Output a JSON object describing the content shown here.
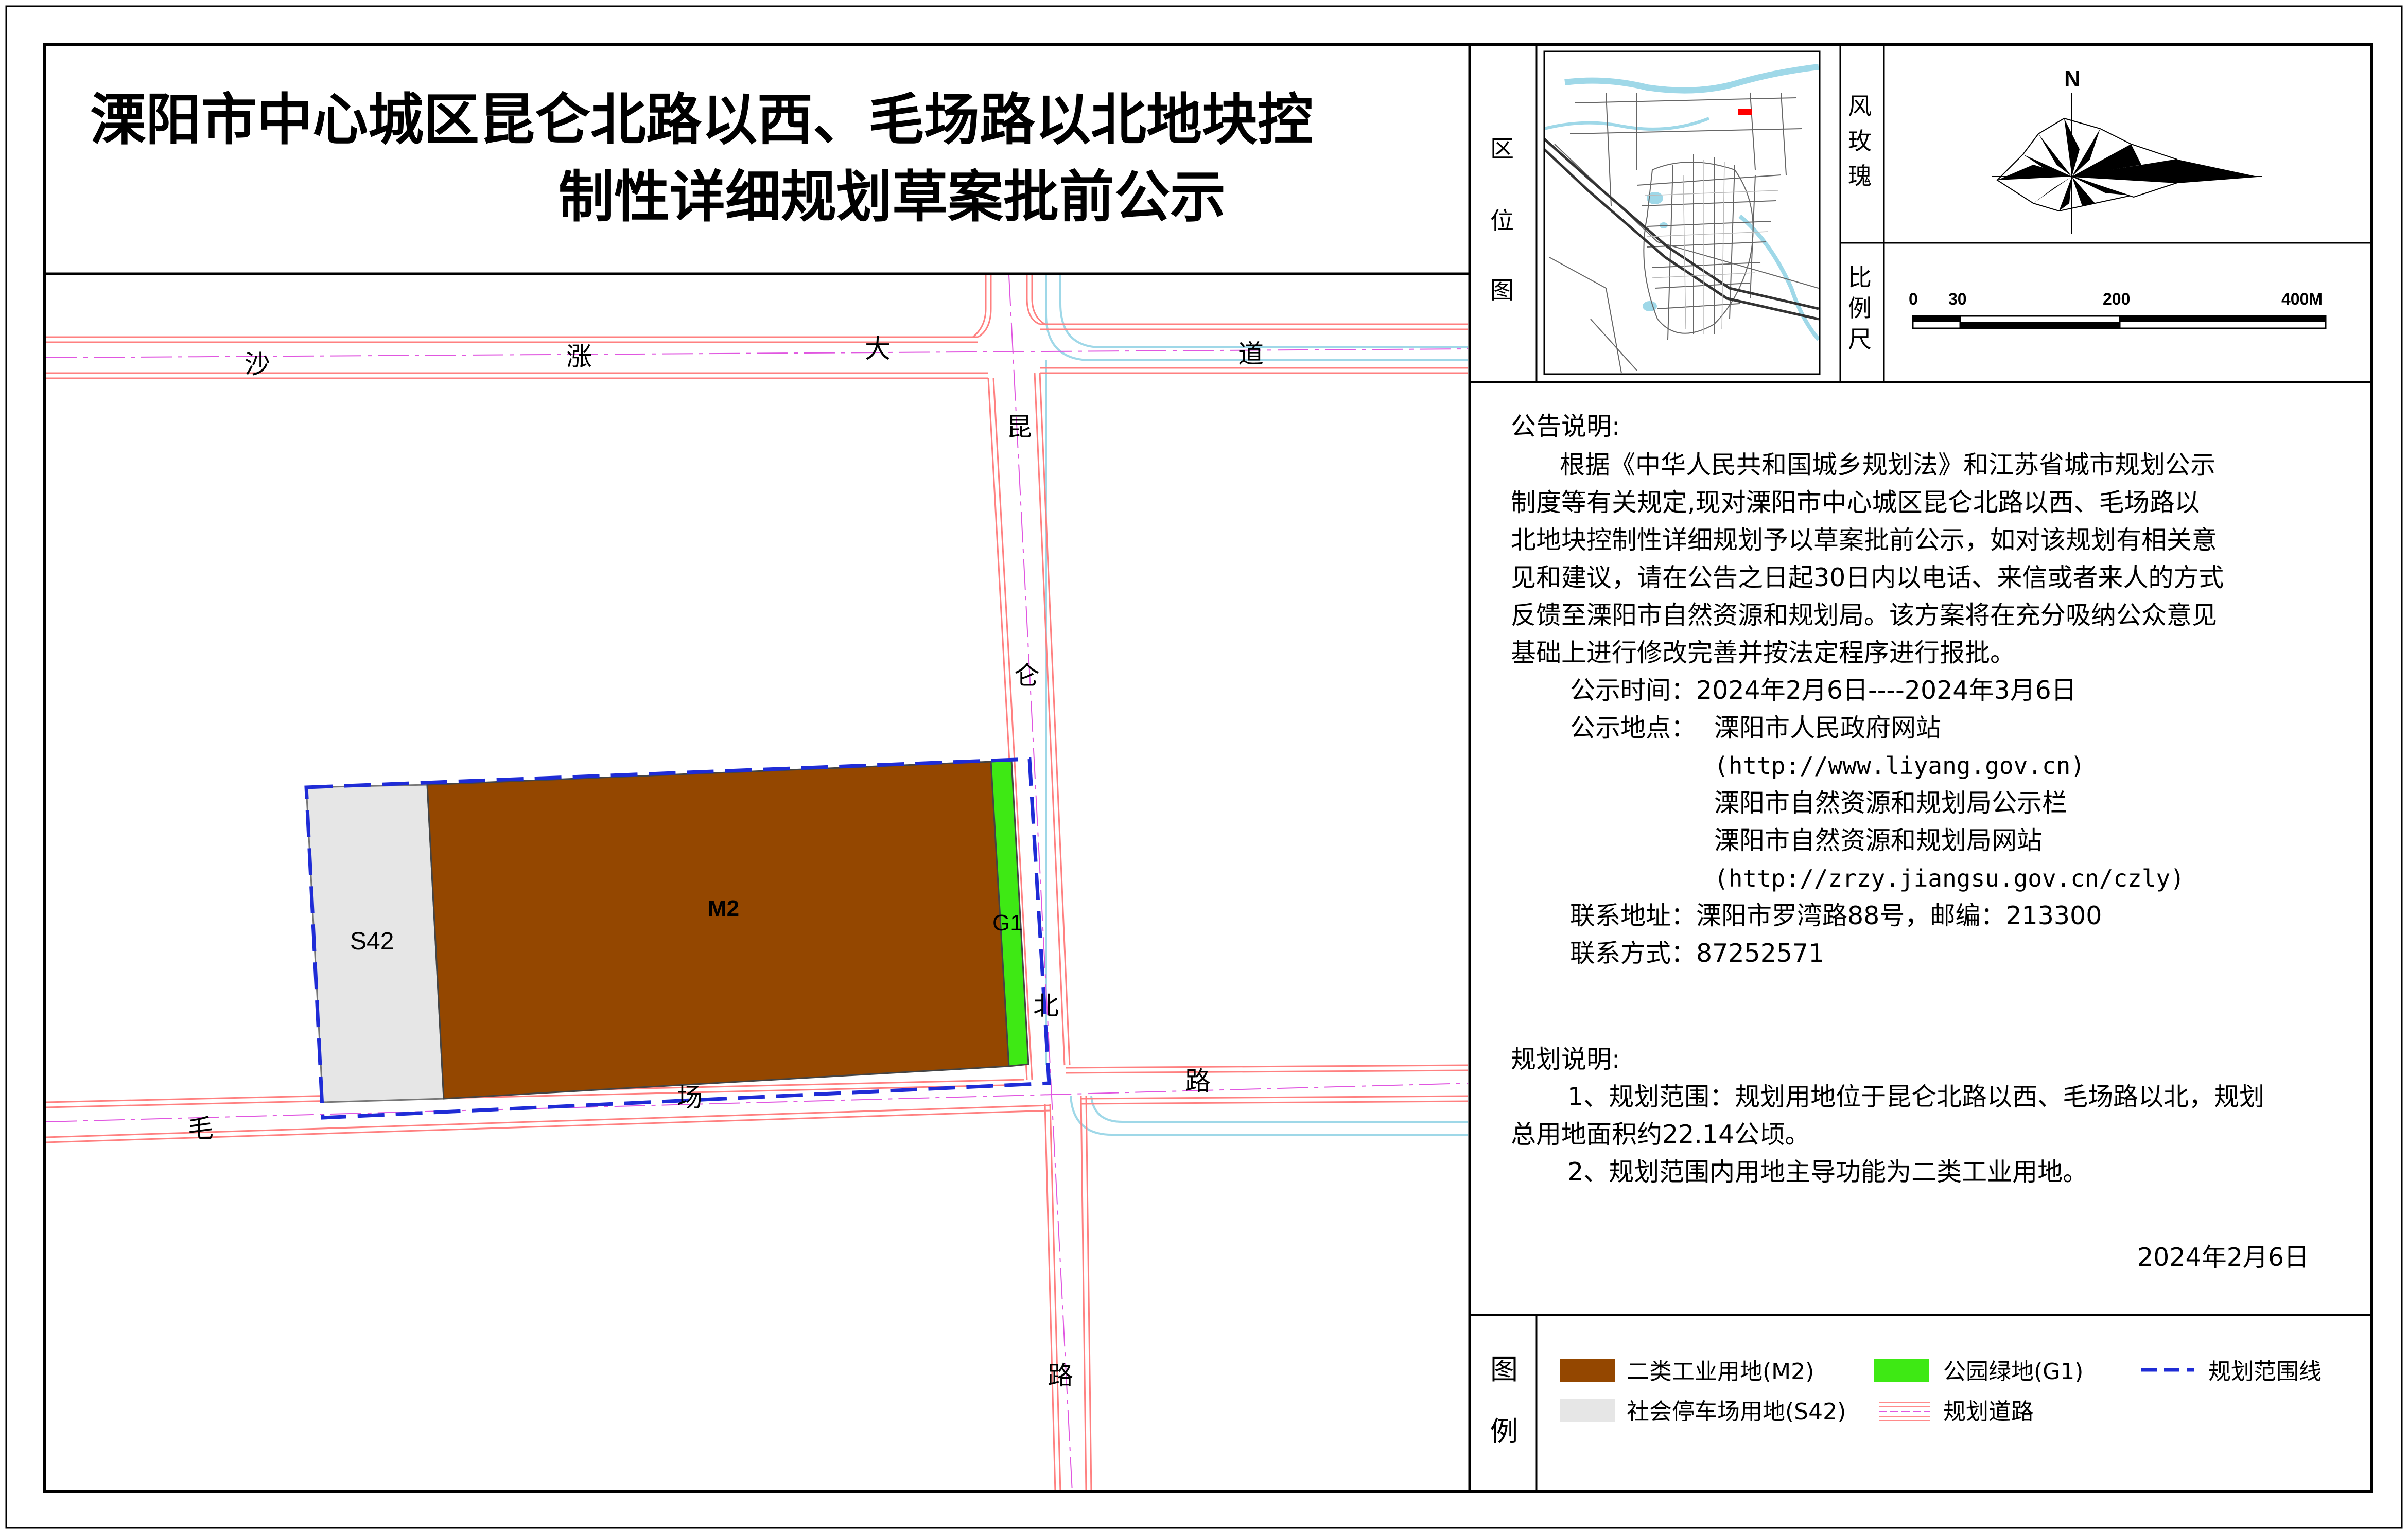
{
  "title": {
    "line1": "溧阳市中心城区昆仑北路以西、毛场路以北地块控",
    "line2": "制性详细规划草案批前公示"
  },
  "locator": {
    "label_chars": [
      "区",
      "位",
      "图"
    ]
  },
  "compass": {
    "label_chars": [
      "风",
      "玫",
      "瑰"
    ],
    "north": "N"
  },
  "scale": {
    "label_chars": [
      "比",
      "例",
      "尺"
    ],
    "ticks": [
      "0",
      "30",
      "200",
      "400M"
    ]
  },
  "roads": {
    "shazhang": [
      "沙",
      "涨",
      "大",
      "道"
    ],
    "kunlun": [
      "昆",
      "仑",
      "北",
      "路"
    ],
    "maochang": [
      "毛",
      "场",
      "路"
    ]
  },
  "parcels": {
    "s42": "S42",
    "m2": "M2",
    "g1": "G1"
  },
  "notice": {
    "heading": "公告说明:",
    "paragraph": [
      "根据《中华人民共和国城乡规划法》和江苏省城市规划公示",
      "制度等有关规定,现对溧阳市中心城区昆仑北路以西、毛场路以",
      "北地块控制性详细规划予以草案批前公示，如对该规划有相关意",
      "见和建议，请在公告之日起30日内以电话、来信或者来人的方式",
      "反馈至溧阳市自然资源和规划局。该方案将在充分吸纳公众意见",
      "基础上进行修改完善并按法定程序进行报批。"
    ],
    "time": "公示时间：2024年2月6日----2024年3月6日",
    "place_label": "公示地点：",
    "places": [
      "溧阳市人民政府网站",
      "(http://www.liyang.gov.cn)",
      "溧阳市自然资源和规划局公示栏",
      "溧阳市自然资源和规划局网站",
      "(http://zrzy.jiangsu.gov.cn/czly)"
    ],
    "address": "联系地址：溧阳市罗湾路88号，邮编：213300",
    "contact": "联系方式：87252571"
  },
  "plan": {
    "heading": "规划说明:",
    "item1_line1": "1、规划范围：规划用地位于昆仑北路以西、毛场路以北，规划",
    "item1_line2": "总用地面积约22.14公顷。",
    "item2": "2、规划范围内用地主导功能为二类工业用地。"
  },
  "date": "2024年2月6日",
  "legend": {
    "label_chars": [
      "图",
      "例"
    ],
    "items": [
      {
        "label": "二类工业用地(M2)",
        "color": "#944700"
      },
      {
        "label": "公园绿地(G1)",
        "color": "#3ee914"
      },
      {
        "label": "规划范围线",
        "color": "#1f2cd6"
      },
      {
        "label": "社会停车场用地(S42)",
        "color": "#e6e6e6"
      },
      {
        "label": "规划道路",
        "color": "#ff8a8a"
      }
    ]
  },
  "colors": {
    "m2": "#944700",
    "g1": "#3ee914",
    "s42": "#e6e6e6",
    "boundary": "#1f2cd6",
    "road_edge": "#ff8080",
    "road_center": "#e056e0",
    "water": "#9fd8e8"
  }
}
